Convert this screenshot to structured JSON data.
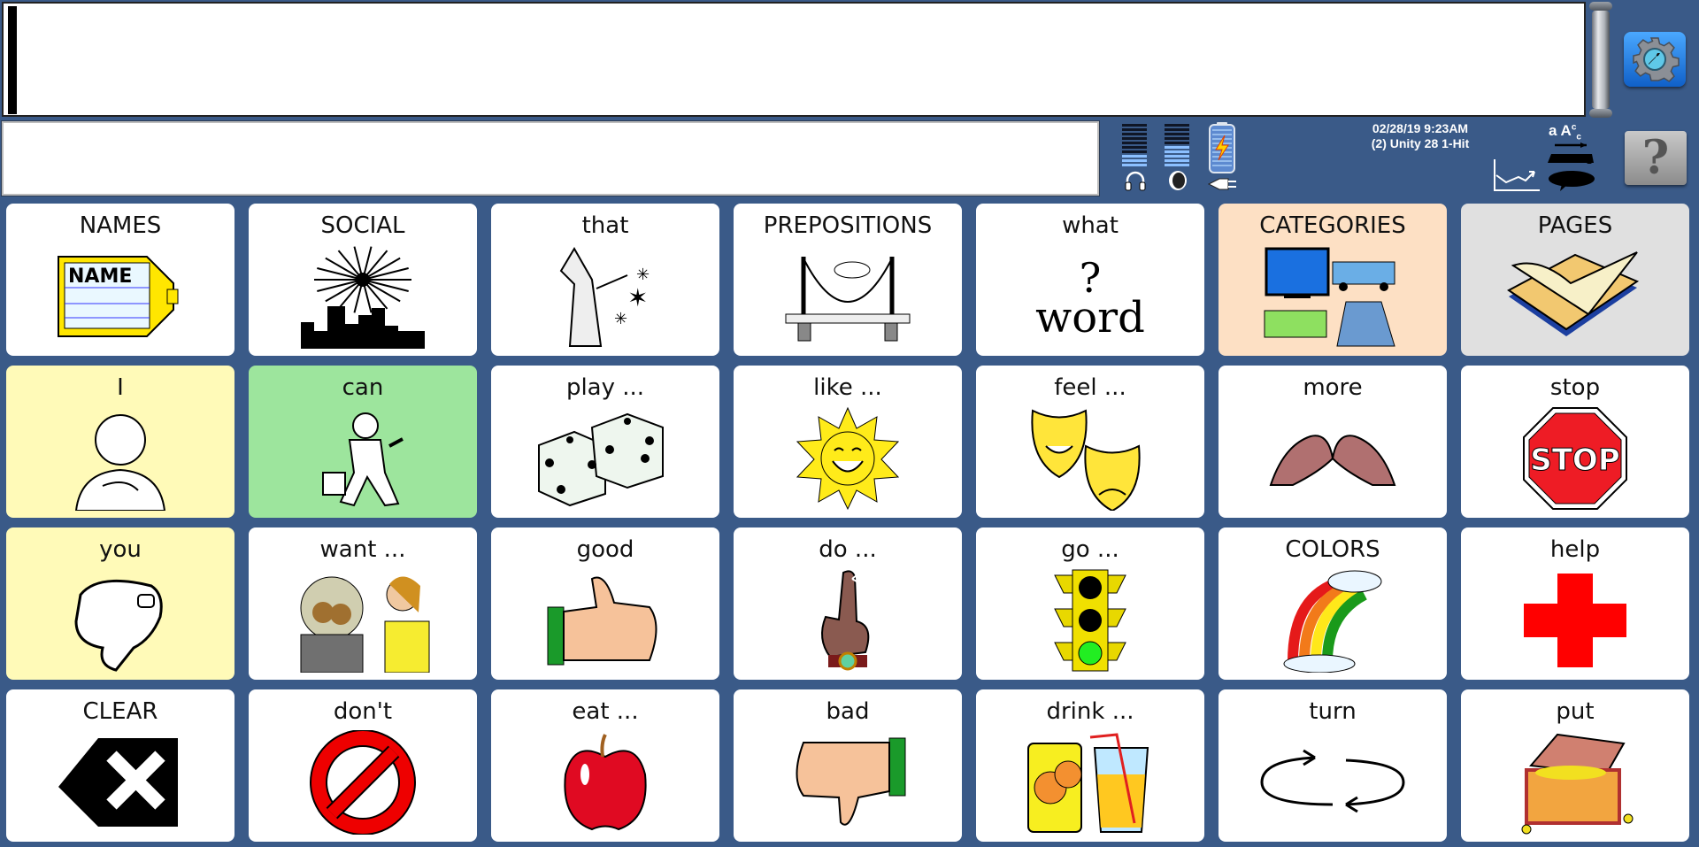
{
  "message_window": {
    "text": "",
    "secondary_text": ""
  },
  "toolbar": {
    "settings_label": "settings",
    "help_label": "?"
  },
  "status": {
    "datetime": "02/28/19 9:23AM",
    "vocabulary": "(2) Unity 28 1-Hit",
    "headphone_volume_level": 0.3,
    "speaker_volume_level": 0.5,
    "battery_level": 1.0,
    "charging": true
  },
  "grid": {
    "rows": [
      [
        {
          "label": "NAMES",
          "icon": "name-tag-icon",
          "bg": "#ffffff"
        },
        {
          "label": "SOCIAL",
          "icon": "fireworks-icon",
          "bg": "#ffffff"
        },
        {
          "label": "that",
          "icon": "wizard-icon",
          "bg": "#ffffff"
        },
        {
          "label": "PREPOSITIONS",
          "icon": "bridge-icon",
          "bg": "#ffffff"
        },
        {
          "label": "what",
          "icon": "question-word-icon",
          "bg": "#ffffff"
        },
        {
          "label": "CATEGORIES",
          "icon": "categories-icon",
          "bg": "#fde0c4"
        },
        {
          "label": "PAGES",
          "icon": "book-icon",
          "bg": "#e0e0e0"
        }
      ],
      [
        {
          "label": "I",
          "icon": "self-icon",
          "bg": "#fffab8"
        },
        {
          "label": "can",
          "icon": "worker-icon",
          "bg": "#9de59d"
        },
        {
          "label": "play ...",
          "icon": "dice-icon",
          "bg": "#ffffff"
        },
        {
          "label": "like ...",
          "icon": "sun-icon",
          "bg": "#ffffff"
        },
        {
          "label": "feel ...",
          "icon": "masks-icon",
          "bg": "#ffffff"
        },
        {
          "label": "more",
          "icon": "more-sign-icon",
          "bg": "#ffffff"
        },
        {
          "label": "stop",
          "icon": "stop-sign-icon",
          "bg": "#ffffff"
        }
      ],
      [
        {
          "label": "you",
          "icon": "pointing-hand-icon",
          "bg": "#fffab8"
        },
        {
          "label": "want ...",
          "icon": "cookie-jar-icon",
          "bg": "#ffffff"
        },
        {
          "label": "good",
          "icon": "thumbs-up-icon",
          "bg": "#ffffff"
        },
        {
          "label": "do ...",
          "icon": "finger-string-icon",
          "bg": "#ffffff"
        },
        {
          "label": "go ...",
          "icon": "traffic-light-icon",
          "bg": "#ffffff"
        },
        {
          "label": "COLORS",
          "icon": "rainbow-icon",
          "bg": "#ffffff"
        },
        {
          "label": "help",
          "icon": "red-cross-icon",
          "bg": "#ffffff"
        }
      ],
      [
        {
          "label": "CLEAR",
          "icon": "backspace-icon",
          "bg": "#ffffff"
        },
        {
          "label": "don't",
          "icon": "prohibited-icon",
          "bg": "#ffffff"
        },
        {
          "label": "eat ...",
          "icon": "apple-icon",
          "bg": "#ffffff"
        },
        {
          "label": "bad",
          "icon": "thumbs-down-icon",
          "bg": "#ffffff"
        },
        {
          "label": "drink ...",
          "icon": "juice-icon",
          "bg": "#ffffff"
        },
        {
          "label": "turn",
          "icon": "rotate-arrows-icon",
          "bg": "#ffffff"
        },
        {
          "label": "put",
          "icon": "treasure-chest-icon",
          "bg": "#ffffff"
        }
      ]
    ]
  },
  "colors": {
    "background": "#3a5a88",
    "status_text": "#ffffff",
    "level_on": "#8cc0ff"
  }
}
